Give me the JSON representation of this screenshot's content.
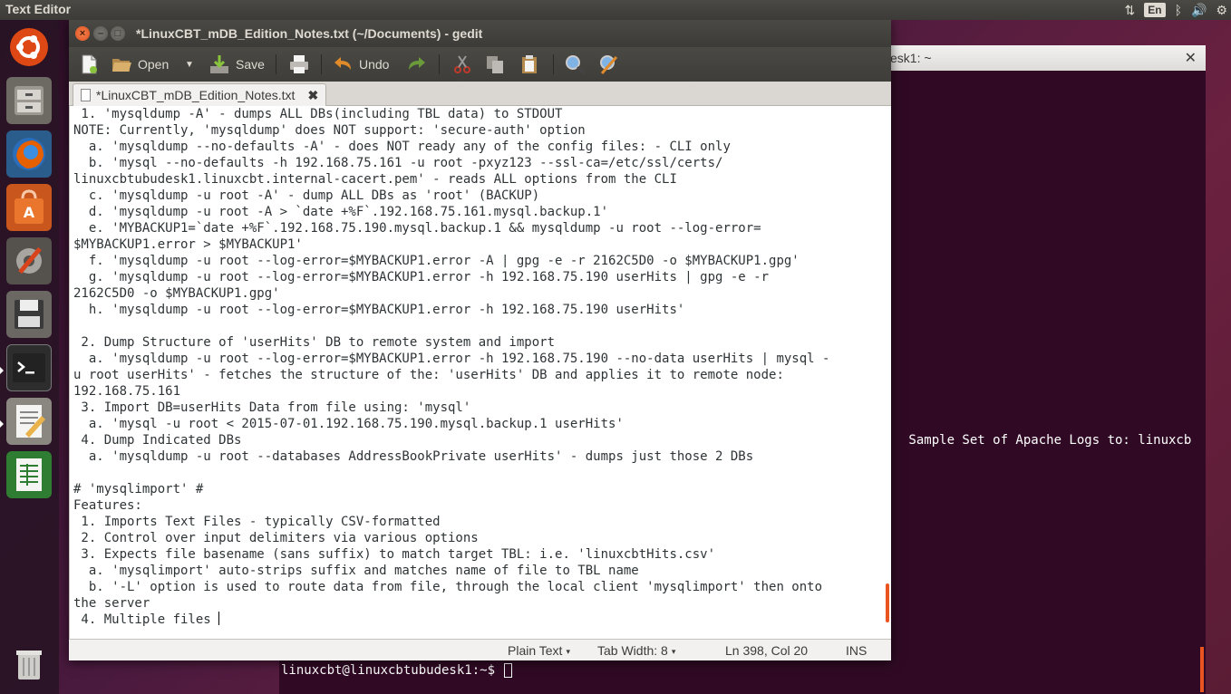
{
  "top_panel": {
    "app_title": "Text Editor",
    "indicators": [
      {
        "name": "network-icon",
        "glyph": "⇅"
      },
      {
        "name": "keyboard-language",
        "label": "En"
      },
      {
        "name": "bluetooth-icon",
        "glyph": "ᛒ"
      },
      {
        "name": "volume-icon",
        "glyph": "🔊"
      },
      {
        "name": "settings-gear-icon",
        "glyph": "⚙"
      }
    ]
  },
  "launcher": {
    "items": [
      "ubuntu-dash",
      "files",
      "firefox",
      "software-center",
      "system-settings",
      "save-device",
      "terminal",
      "text-editor",
      "spreadsheet",
      "trash"
    ]
  },
  "terminal": {
    "title": "esk1: ~",
    "close_glyph": "✕",
    "text_fragment": " Sample Set of Apache Logs to: linuxcb",
    "prompt": "linuxcbt@linuxcbtubudesk1:~$ "
  },
  "gedit": {
    "title": "*LinuxCBT_mDB_Edition_Notes.txt (~/Documents) - gedit",
    "window_buttons": {
      "close": "×",
      "minimize": "–",
      "maximize": "□"
    },
    "toolbar": {
      "open_label": "Open",
      "save_label": "Save",
      "undo_label": "Undo"
    },
    "tab": {
      "label": "*LinuxCBT_mDB_Edition_Notes.txt",
      "close_glyph": "✖"
    },
    "lines": [
      " 1. 'mysqldump -A' - dumps ALL DBs(including TBL data) to STDOUT",
      "NOTE: Currently, 'mysqldump' does NOT support: 'secure-auth' option",
      "  a. 'mysqldump --no-defaults -A' - does NOT ready any of the config files: - CLI only",
      "  b. 'mysql --no-defaults -h 192.168.75.161 -u root -pxyz123 --ssl-ca=/etc/ssl/certs/",
      "linuxcbtubudesk1.linuxcbt.internal-cacert.pem' - reads ALL options from the CLI",
      "  c. 'mysqldump -u root -A' - dump ALL DBs as 'root' (BACKUP)",
      "  d. 'mysqldump -u root -A > `date +%F`.192.168.75.161.mysql.backup.1'",
      "  e. 'MYBACKUP1=`date +%F`.192.168.75.190.mysql.backup.1 && mysqldump -u root --log-error=",
      "$MYBACKUP1.error > $MYBACKUP1'",
      "  f. 'mysqldump -u root --log-error=$MYBACKUP1.error -A | gpg -e -r 2162C5D0 -o $MYBACKUP1.gpg'",
      "  g. 'mysqldump -u root --log-error=$MYBACKUP1.error -h 192.168.75.190 userHits | gpg -e -r",
      "2162C5D0 -o $MYBACKUP1.gpg'",
      "  h. 'mysqldump -u root --log-error=$MYBACKUP1.error -h 192.168.75.190 userHits'",
      "",
      " 2. Dump Structure of 'userHits' DB to remote system and import",
      "  a. 'mysqldump -u root --log-error=$MYBACKUP1.error -h 192.168.75.190 --no-data userHits | mysql -",
      "u root userHits' - fetches the structure of the: 'userHits' DB and applies it to remote node:",
      "192.168.75.161",
      " 3. Import DB=userHits Data from file using: 'mysql'",
      "  a. 'mysql -u root < 2015-07-01.192.168.75.190.mysql.backup.1 userHits'",
      " 4. Dump Indicated DBs",
      "  a. 'mysqldump -u root --databases AddressBookPrivate userHits' - dumps just those 2 DBs",
      "",
      "# 'mysqlimport' #",
      "Features:",
      " 1. Imports Text Files - typically CSV-formatted",
      " 2. Control over input delimiters via various options",
      " 3. Expects file basename (sans suffix) to match target TBL: i.e. 'linuxcbtHits.csv'",
      "  a. 'mysqlimport' auto-strips suffix and matches name of file to TBL name",
      "  b. '-L' option is used to route data from file, through the local client 'mysqlimport' then onto",
      "the server",
      " 4. Multiple files "
    ],
    "status": {
      "language": "Plain Text",
      "tab_width": "Tab Width: 8",
      "position": "Ln 398, Col 20",
      "mode": "INS",
      "dropdown_glyph": "▾"
    }
  },
  "colors": {
    "accent": "#e95420",
    "panel": "#3c3b37",
    "terminal_bg": "#300a24"
  }
}
